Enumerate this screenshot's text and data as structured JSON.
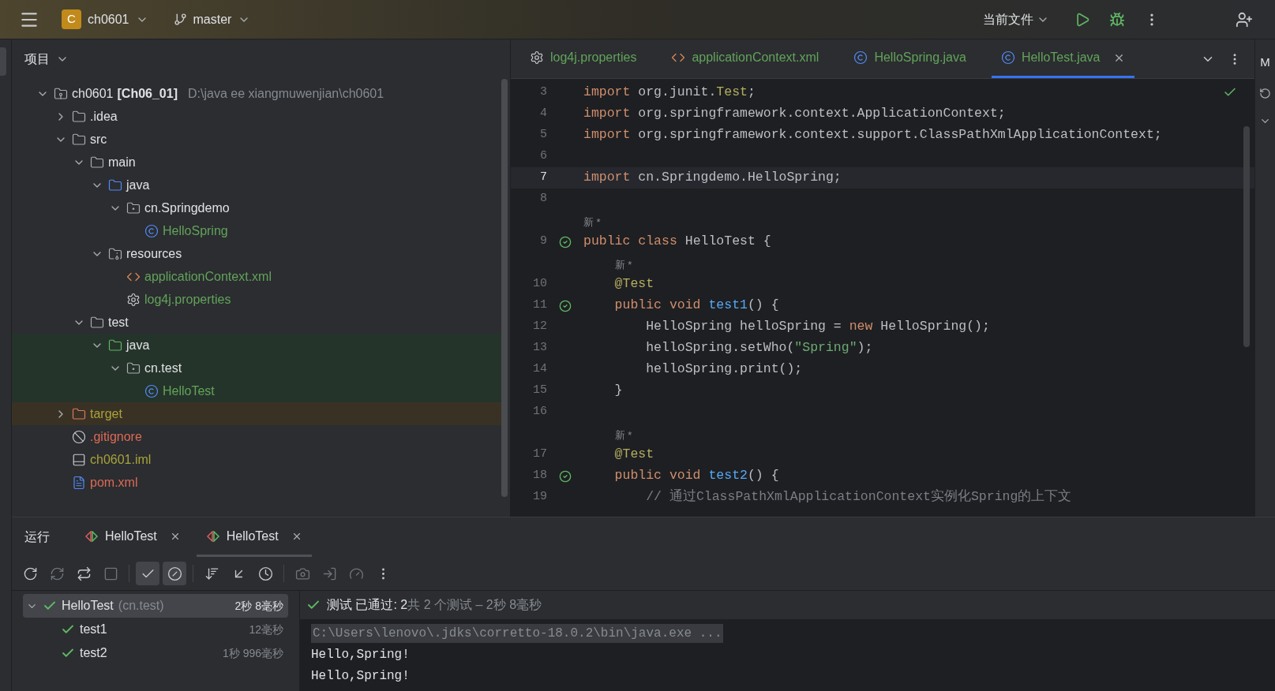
{
  "top_bar": {
    "project": {
      "badge": "C",
      "name": "ch0601"
    },
    "branch": "master",
    "run_config": "当前文件"
  },
  "project_panel": {
    "title": "项目",
    "tree": [
      {
        "kind": "module",
        "name": "ch0601",
        "tag": "[Ch06_01]",
        "path": "D:\\java ee xiangmuwenjian\\ch0601",
        "expanded": true,
        "children": [
          {
            "kind": "folder",
            "name": ".idea",
            "expanded": false
          },
          {
            "kind": "folder",
            "name": "src",
            "expanded": true,
            "children": [
              {
                "kind": "folder",
                "name": "main",
                "expanded": true,
                "children": [
                  {
                    "kind": "source",
                    "name": "java",
                    "expanded": true,
                    "children": [
                      {
                        "kind": "package",
                        "name": "cn.Springdemo",
                        "expanded": true,
                        "children": [
                          {
                            "kind": "class",
                            "name": "HelloSpring",
                            "color": "#62a35a"
                          }
                        ]
                      }
                    ]
                  },
                  {
                    "kind": "resources",
                    "name": "resources",
                    "expanded": true,
                    "children": [
                      {
                        "kind": "xml",
                        "name": "applicationContext.xml",
                        "color": "#62a35a"
                      },
                      {
                        "kind": "properties",
                        "name": "log4j.properties",
                        "color": "#62a35a"
                      }
                    ]
                  }
                ]
              },
              {
                "kind": "folder",
                "name": "test",
                "expanded": true,
                "children": [
                  {
                    "kind": "test-source",
                    "name": "java",
                    "expanded": true,
                    "row": {
                      "color": "#25342a"
                    },
                    "children": [
                      {
                        "kind": "package",
                        "name": "cn.test",
                        "expanded": true,
                        "row": {
                          "color": "#25342a"
                        },
                        "children": [
                          {
                            "kind": "class",
                            "name": "HelloTest",
                            "color": "#62a35a",
                            "row": {
                              "color": "#25342a"
                            }
                          }
                        ]
                      }
                    ]
                  }
                ]
              }
            ]
          },
          {
            "kind": "excluded",
            "name": "target",
            "expanded": false,
            "color": "#a8a33a",
            "row": {
              "color": "#3a3125"
            }
          },
          {
            "kind": "ignore",
            "name": ".gitignore",
            "color": "#dc6a55"
          },
          {
            "kind": "iml",
            "name": "ch0601.iml",
            "color": "#a8a33a"
          },
          {
            "kind": "maven",
            "name": "pom.xml",
            "color": "#dc6a55"
          }
        ]
      }
    ]
  },
  "editor": {
    "tabs": [
      {
        "kind": "properties",
        "label": "log4j.properties",
        "selected": false
      },
      {
        "kind": "xml",
        "label": "applicationContext.xml",
        "selected": false
      },
      {
        "kind": "class",
        "label": "HelloSpring.java",
        "selected": false
      },
      {
        "kind": "class",
        "label": "HelloTest.java",
        "selected": true
      }
    ],
    "lines": [
      {
        "number": "3",
        "current": false,
        "run": false,
        "tokens": [
          {
            "color": "#cf8e6d",
            "s": "import "
          },
          {
            "color": "#bcbec4",
            "s": "org.junit."
          },
          {
            "color": "#b3ae60",
            "s": "Test"
          },
          {
            "color": "#bcbec4",
            "s": ";"
          }
        ]
      },
      {
        "number": "4",
        "current": false,
        "run": false,
        "tokens": [
          {
            "color": "#cf8e6d",
            "s": "import "
          },
          {
            "color": "#bcbec4",
            "s": "org.springframework.context.ApplicationContext;"
          }
        ]
      },
      {
        "number": "5",
        "current": false,
        "run": false,
        "tokens": [
          {
            "color": "#cf8e6d",
            "s": "import "
          },
          {
            "color": "#bcbec4",
            "s": "org.springframework.context.support.ClassPathXmlApplicationContext;"
          }
        ]
      },
      {
        "number": "6",
        "current": false,
        "run": false
      },
      {
        "number": "7",
        "current": true,
        "run": false,
        "tokens": [
          {
            "color": "#cf8e6d",
            "s": "import "
          },
          {
            "color": "#bcbec4",
            "s": "cn.Springdemo.HelloSpring;"
          }
        ]
      },
      {
        "number": "8",
        "current": false,
        "run": false
      },
      {
        "number": "9",
        "current": false,
        "run": true,
        "hint": "新 *",
        "tokens": [
          {
            "color": "#cf8e6d",
            "s": "public class "
          },
          {
            "color": "#bcbec4",
            "s": "HelloTest {"
          }
        ]
      },
      {
        "number": "10",
        "current": false,
        "run": false,
        "hint": "新 *",
        "tokens": [
          {
            "color": "#b3ae60",
            "s": "    @Test"
          }
        ]
      },
      {
        "number": "11",
        "current": false,
        "run": true,
        "tokens": [
          {
            "color": "#cf8e6d",
            "s": "    public void "
          },
          {
            "color": "#56a8f5",
            "s": "test1"
          },
          {
            "color": "#bcbec4",
            "s": "() {"
          }
        ]
      },
      {
        "number": "12",
        "current": false,
        "run": false,
        "tokens": [
          {
            "color": "#bcbec4",
            "s": "        HelloSpring helloSpring = "
          },
          {
            "color": "#cf8e6d",
            "s": "new "
          },
          {
            "color": "#bcbec4",
            "s": "HelloSpring();"
          }
        ]
      },
      {
        "number": "13",
        "current": false,
        "run": false,
        "tokens": [
          {
            "color": "#bcbec4",
            "s": "        helloSpring.setWho("
          },
          {
            "color": "#6aab73",
            "s": "\"Spring\""
          },
          {
            "color": "#bcbec4",
            "s": ");"
          }
        ]
      },
      {
        "number": "14",
        "current": false,
        "run": false,
        "tokens": [
          {
            "color": "#bcbec4",
            "s": "        helloSpring.print();"
          }
        ]
      },
      {
        "number": "15",
        "current": false,
        "run": false,
        "tokens": [
          {
            "color": "#bcbec4",
            "s": "    }"
          }
        ]
      },
      {
        "number": "16",
        "current": false,
        "run": false
      },
      {
        "number": "17",
        "current": false,
        "run": false,
        "hint": "新 *",
        "tokens": [
          {
            "color": "#b3ae60",
            "s": "    @Test"
          }
        ]
      },
      {
        "number": "18",
        "current": false,
        "run": true,
        "tokens": [
          {
            "color": "#cf8e6d",
            "s": "    public void "
          },
          {
            "color": "#56a8f5",
            "s": "test2"
          },
          {
            "color": "#bcbec4",
            "s": "() {"
          }
        ]
      },
      {
        "number": "19",
        "current": false,
        "run": false,
        "tokens": [
          {
            "color": "#7a7e85",
            "s": "        // 通过ClassPathXmlApplicationContext实例化Spring的上下文"
          }
        ]
      }
    ]
  },
  "right_strip": {
    "label": "M"
  },
  "run_panel": {
    "title": "运行",
    "tabs": [
      {
        "label": "HelloTest",
        "selected": false
      },
      {
        "label": "HelloTest",
        "selected": true
      }
    ],
    "filters": {
      "show_passed": true,
      "show_ignored": true
    },
    "tests": [
      {
        "name": "HelloTest",
        "package": "(cn.test)",
        "time": "2秒 8毫秒",
        "passed": true,
        "selected": true,
        "expanded": true,
        "children": [
          {
            "name": "test1",
            "time": "12毫秒",
            "passed": true,
            "selected": false
          },
          {
            "name": "test2",
            "time": "1秒 996毫秒",
            "passed": true,
            "selected": false
          }
        ]
      }
    ],
    "summary": {
      "passed": true,
      "main": "测试 已通过: 2",
      "detail": "共 2 个测试 – 2秒 8毫秒"
    },
    "console": [
      {
        "kind": "command",
        "text": "C:\\Users\\lenovo\\.jdks\\corretto-18.0.2\\bin\\java.exe ..."
      },
      {
        "kind": "output",
        "text": "Hello,Spring!"
      },
      {
        "kind": "output",
        "text": "Hello,Spring!"
      }
    ]
  }
}
